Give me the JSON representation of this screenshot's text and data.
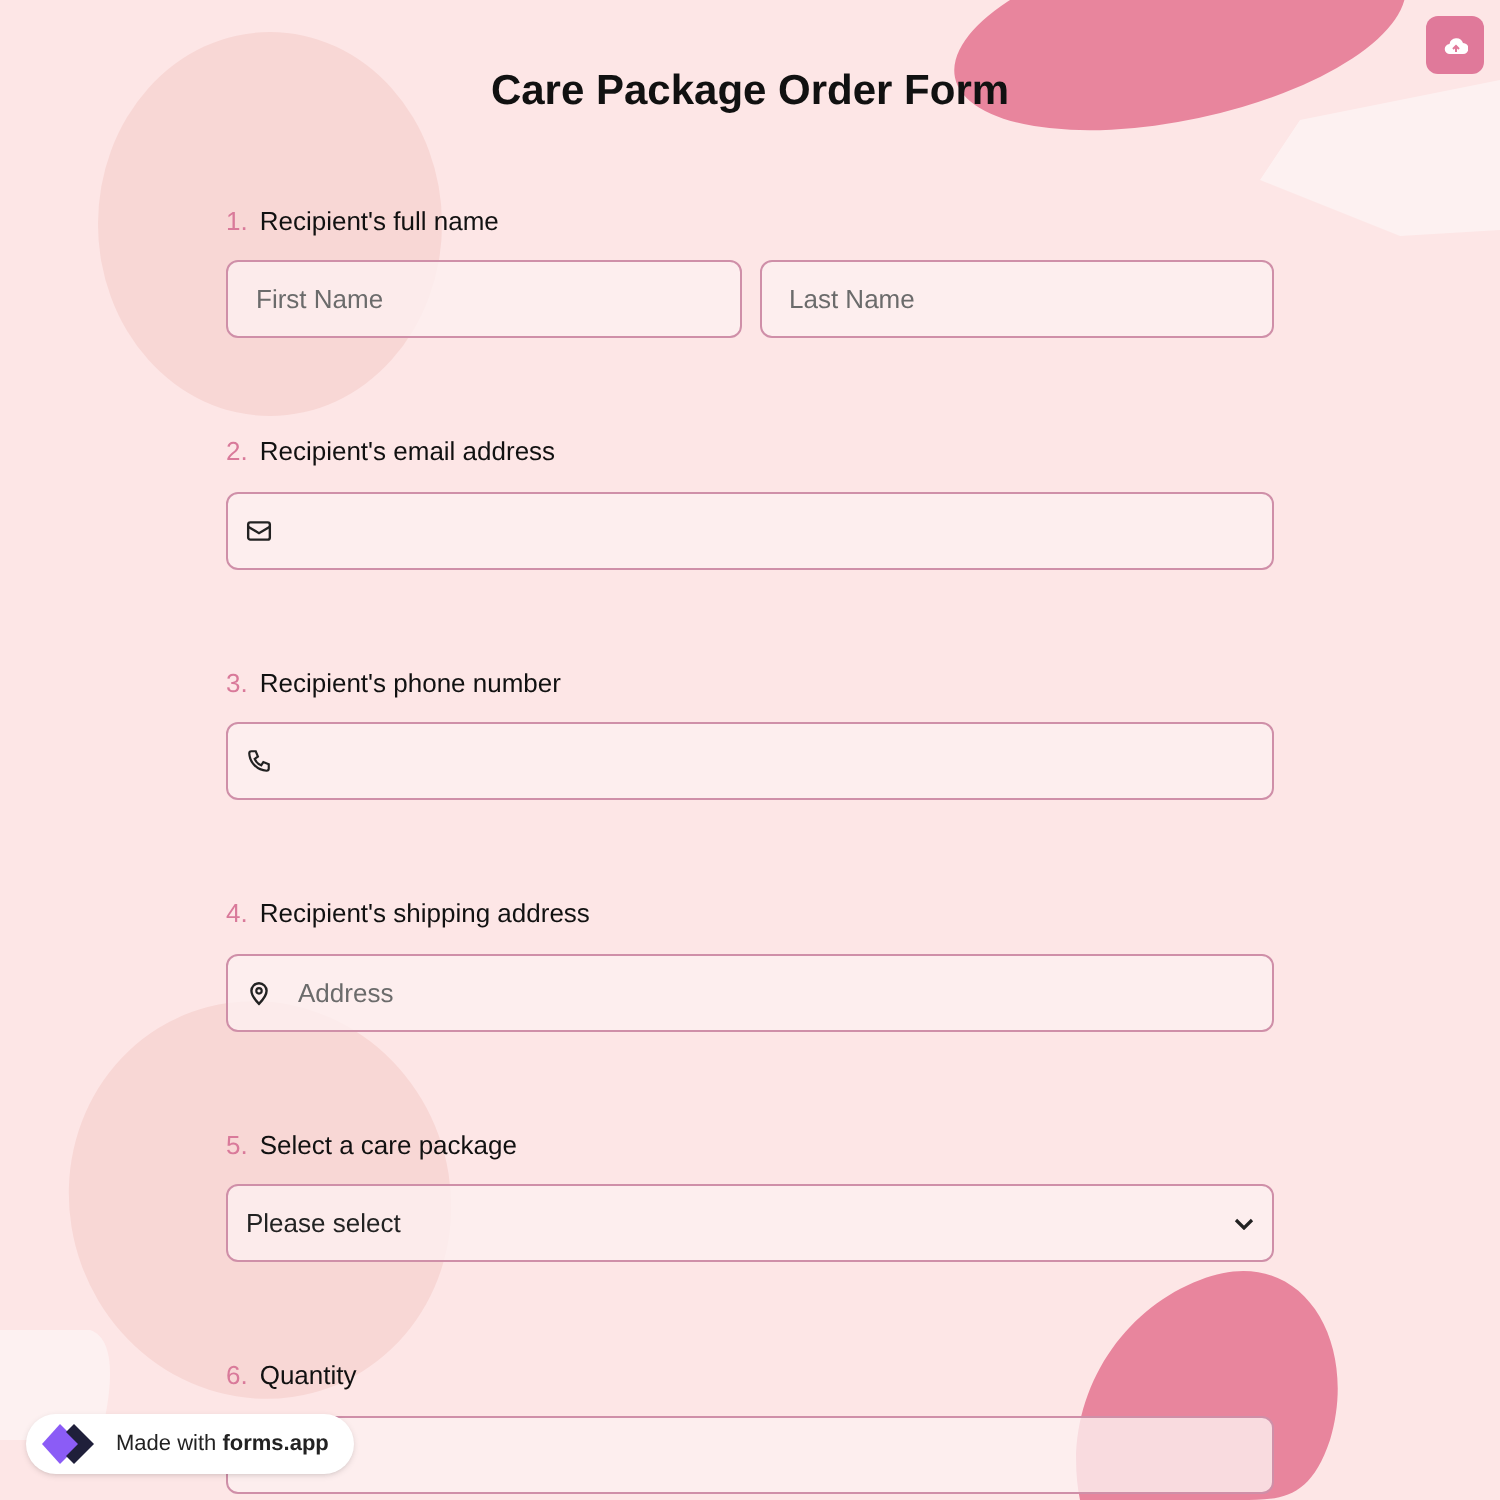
{
  "title": "Care Package Order Form",
  "questions": [
    {
      "number": "1.",
      "label": "Recipient's full name",
      "kind": "name",
      "fields": [
        {
          "placeholder": "First Name"
        },
        {
          "placeholder": "Last Name"
        }
      ]
    },
    {
      "number": "2.",
      "label": "Recipient's email address",
      "kind": "email"
    },
    {
      "number": "3.",
      "label": "Recipient's phone number",
      "kind": "phone"
    },
    {
      "number": "4.",
      "label": "Recipient's shipping address",
      "kind": "address",
      "placeholder": "Address"
    },
    {
      "number": "5.",
      "label": "Select a care package",
      "kind": "select",
      "value": "Please select"
    },
    {
      "number": "6.",
      "label": "Quantity",
      "kind": "number"
    }
  ],
  "badge": "Made with **forms.app**"
}
